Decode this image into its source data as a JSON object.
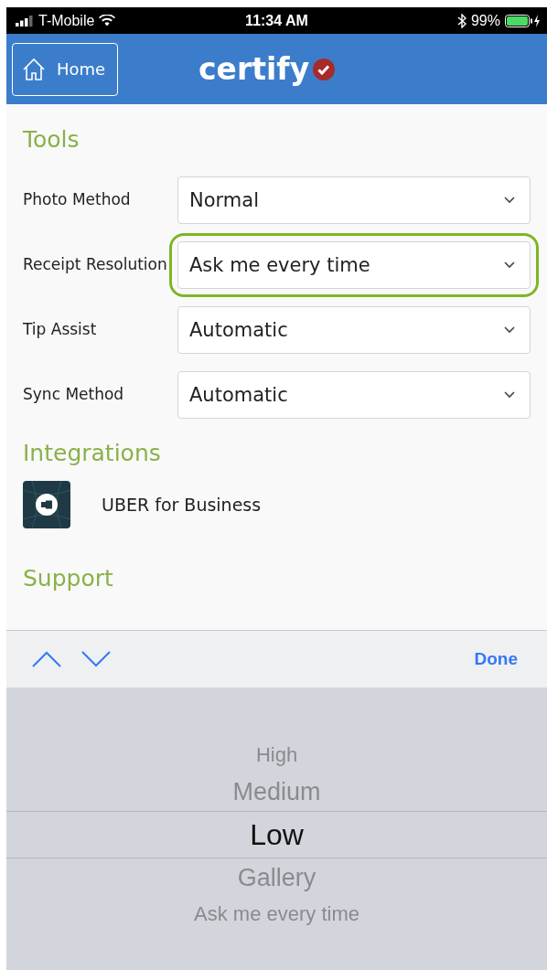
{
  "status_bar": {
    "carrier": "T-Mobile",
    "time": "11:34 AM",
    "battery": "99%"
  },
  "header": {
    "home_button": "Home",
    "logo": "certify"
  },
  "sections": [
    {
      "title": "Tools",
      "settings": [
        {
          "label": "Photo Method",
          "value": "Normal",
          "focused": false
        },
        {
          "label": "Receipt Resolution",
          "value": "Ask me every time",
          "focused": true
        },
        {
          "label": "Tip Assist",
          "value": "Automatic",
          "focused": false
        },
        {
          "label": "Sync Method",
          "value": "Automatic",
          "focused": false
        }
      ]
    },
    {
      "title": "Integrations",
      "integrations": [
        {
          "name": "UBER for Business"
        }
      ]
    },
    {
      "title": "Support"
    }
  ],
  "picker_toolbar": {
    "done": "Done"
  },
  "picker": [
    {
      "label": "High",
      "selected": false
    },
    {
      "label": "Medium",
      "selected": false
    },
    {
      "label": "Low",
      "selected": true
    },
    {
      "label": "Gallery",
      "selected": false
    },
    {
      "label": "Ask me every time",
      "selected": false
    }
  ]
}
